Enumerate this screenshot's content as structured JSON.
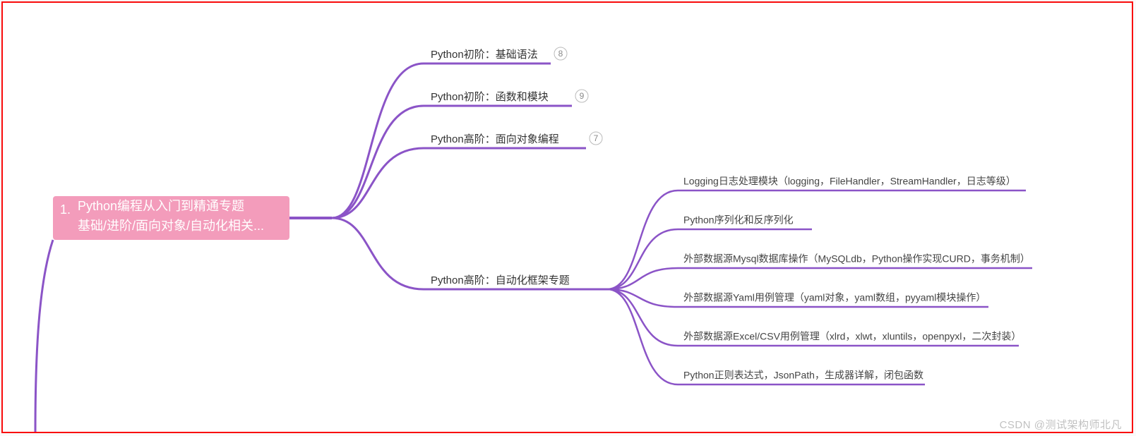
{
  "root": {
    "prefix": "1.",
    "line1": "Python编程从入门到精通专题",
    "line2": "基础/进阶/面向对象/自动化相关..."
  },
  "branches": [
    {
      "label": "Python初阶：基础语法",
      "badge": "8"
    },
    {
      "label": "Python初阶：函数和模块",
      "badge": "9"
    },
    {
      "label": "Python高阶：面向对象编程",
      "badge": "7"
    },
    {
      "label": "Python高阶：自动化框架专题",
      "children": [
        "Logging日志处理模块（logging，FileHandler，StreamHandler，日志等级）",
        "Python序列化和反序列化",
        "外部数据源Mysql数据库操作（MySQLdb，Python操作实现CURD，事务机制）",
        "外部数据源Yaml用例管理（yaml对象，yaml数组，pyyaml模块操作）",
        "外部数据源Excel/CSV用例管理（xlrd，xlwt，xluntils，openpyxl，二次封装）",
        "Python正则表达式，JsonPath，生成器详解，闭包函数"
      ]
    }
  ],
  "watermark": "CSDN @测试架构师北凡",
  "colors": {
    "line": "#8b54c7",
    "root": "#f39cbb"
  }
}
